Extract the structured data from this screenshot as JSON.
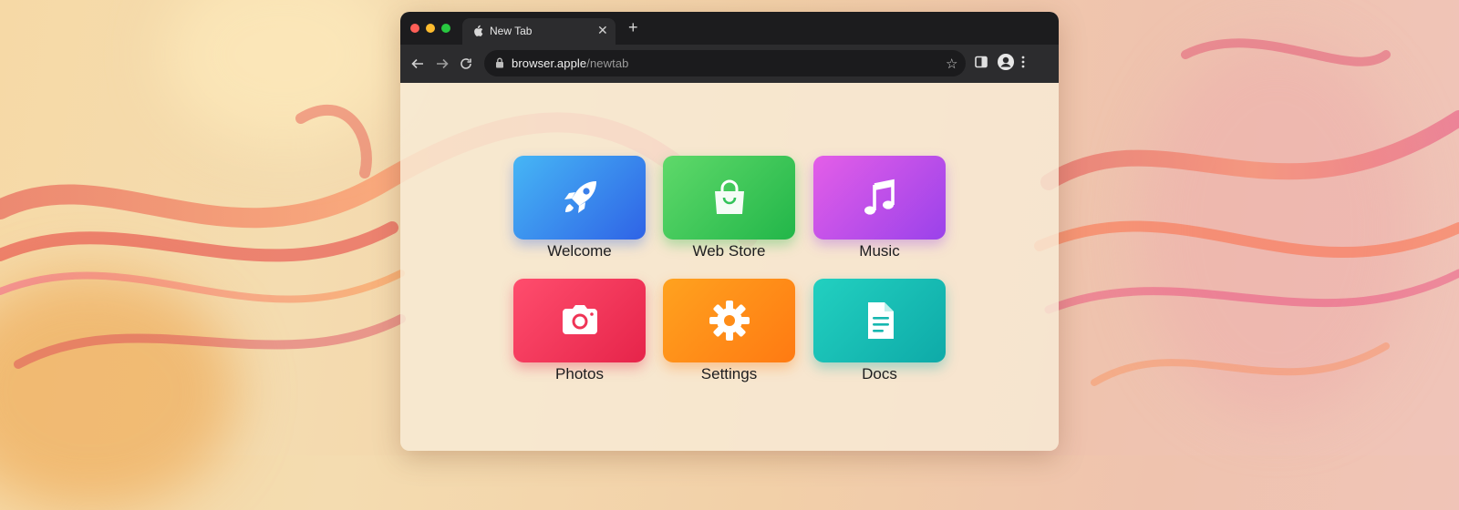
{
  "window": {
    "tab_title": "New Tab",
    "tab_close_icon": "close-icon",
    "new_tab_label": "+",
    "traffic_colors": [
      "#ff5f57",
      "#febc2e",
      "#28c840"
    ]
  },
  "toolbar": {
    "url_host": "browser.apple",
    "url_path": "/newtab",
    "icons": [
      "back-arrow-icon",
      "forward-arrow-icon",
      "reload-icon",
      "lock-icon",
      "star-icon",
      "sidebar-icon",
      "profile-icon",
      "more-menu-icon"
    ]
  },
  "shortcuts": [
    {
      "label": "Welcome",
      "icon": "rocket-icon",
      "colors": [
        "#46b6f5",
        "#2f63e6"
      ]
    },
    {
      "label": "Web Store",
      "icon": "shopping-bag-icon",
      "colors": [
        "#5fd96a",
        "#22b649"
      ]
    },
    {
      "label": "Music",
      "icon": "music-note-icon",
      "colors": [
        "#e45ee8",
        "#9a42ea"
      ]
    },
    {
      "label": "Photos",
      "icon": "camera-icon",
      "colors": [
        "#ff4d6d",
        "#e6244a"
      ]
    },
    {
      "label": "Settings",
      "icon": "gear-icon",
      "colors": [
        "#ffa21f",
        "#ff7a12"
      ]
    },
    {
      "label": "Docs",
      "icon": "document-icon",
      "colors": [
        "#22d0c0",
        "#0eaaa8"
      ]
    }
  ]
}
